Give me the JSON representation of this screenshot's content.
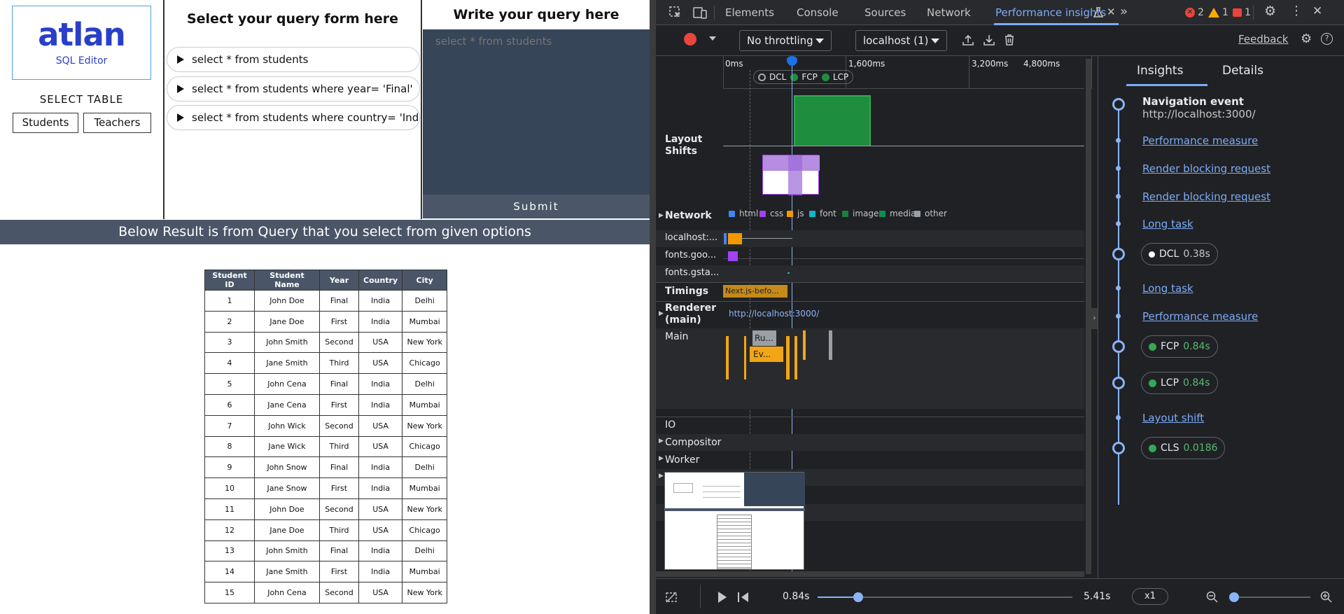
{
  "app": {
    "logo_word": "atlan",
    "logo_sub": "SQL Editor",
    "select_table_label": "SELECT TABLE",
    "table_buttons": [
      "Students",
      "Teachers"
    ],
    "query_form_title": "Select your query form here",
    "query_options": [
      "select * from students",
      "select * from students where year= 'Final'",
      "select * from students where country= 'India'"
    ],
    "write_title": "Write your query here",
    "query_placeholder": "select * from students",
    "submit_label": "Submit",
    "result_banner": "Below Result is from Query that you select from given options",
    "results": {
      "headers": [
        "Student ID",
        "Student Name",
        "Year",
        "Country",
        "City"
      ],
      "rows": [
        [
          "1",
          "John Doe",
          "Final",
          "India",
          "Delhi"
        ],
        [
          "2",
          "Jane Doe",
          "First",
          "India",
          "Mumbai"
        ],
        [
          "3",
          "John Smith",
          "Second",
          "USA",
          "New York"
        ],
        [
          "4",
          "Jane Smith",
          "Third",
          "USA",
          "Chicago"
        ],
        [
          "5",
          "John Cena",
          "Final",
          "India",
          "Delhi"
        ],
        [
          "6",
          "Jane Cena",
          "First",
          "India",
          "Mumbai"
        ],
        [
          "7",
          "John Wick",
          "Second",
          "USA",
          "New York"
        ],
        [
          "8",
          "Jane Wick",
          "Third",
          "USA",
          "Chicago"
        ],
        [
          "9",
          "John Snow",
          "Final",
          "India",
          "Delhi"
        ],
        [
          "10",
          "Jane Snow",
          "First",
          "India",
          "Mumbai"
        ],
        [
          "11",
          "John Doe",
          "Second",
          "USA",
          "New York"
        ],
        [
          "12",
          "Jane Doe",
          "Third",
          "USA",
          "Chicago"
        ],
        [
          "13",
          "John Smith",
          "Final",
          "India",
          "Delhi"
        ],
        [
          "14",
          "Jane Smith",
          "First",
          "India",
          "Mumbai"
        ],
        [
          "15",
          "John Cena",
          "Second",
          "USA",
          "New York"
        ]
      ]
    }
  },
  "devtools": {
    "tabs": [
      "Elements",
      "Console",
      "Sources",
      "Network",
      "Performance insights"
    ],
    "active_tab": "Performance insights",
    "error_count": "2",
    "warning_count": "1",
    "issue_count": "1",
    "throttling": "No throttling",
    "target": "localhost (1)",
    "feedback": "Feedback",
    "ruler_ticks": [
      "0ms",
      "1,600ms",
      "3,200ms",
      "4,800ms"
    ],
    "markers": [
      "DCL",
      "FCP",
      "LCP"
    ],
    "tracks": {
      "layout_shifts": "Layout Shifts",
      "network": "Network",
      "timings": "Timings",
      "renderer": "Renderer (main)",
      "main": "Main",
      "io": "IO",
      "compositor": "Compositor",
      "worker": "Worker"
    },
    "legend": [
      "html",
      "css",
      "js",
      "font",
      "image",
      "media",
      "other"
    ],
    "legend_colors": [
      "#4285f4",
      "#a142f4",
      "#f29900",
      "#12b5cb",
      "#188038",
      "#0d904f",
      "#9aa0a6"
    ],
    "network_rows": [
      "localhost:...",
      "fonts.goo...",
      "fonts.gsta..."
    ],
    "timing_label": "Next.js-befo...",
    "renderer_url": "http://localhost:3000/",
    "main_tasks": [
      "Ru...",
      "Ev..."
    ],
    "playback": {
      "current": "0.84s",
      "total": "5.41s",
      "speed": "x1",
      "progress": 0.16
    },
    "insights": {
      "tab_insights": "Insights",
      "tab_details": "Details",
      "nav_title": "Navigation event",
      "nav_url": "http://localhost:3000/",
      "links": {
        "perf_measure_1": "Performance measure",
        "render_blocking_1": "Render blocking request",
        "render_blocking_2": "Render blocking request",
        "long_task_1": "Long task",
        "long_task_2": "Long task",
        "perf_measure_2": "Performance measure",
        "layout_shift": "Layout shift"
      },
      "metrics": {
        "dcl_label": "DCL",
        "dcl_value": "0.38s",
        "fcp_label": "FCP",
        "fcp_value": "0.84s",
        "lcp_label": "LCP",
        "lcp_value": "0.84s",
        "cls_label": "CLS",
        "cls_value": "0.0186"
      }
    }
  }
}
